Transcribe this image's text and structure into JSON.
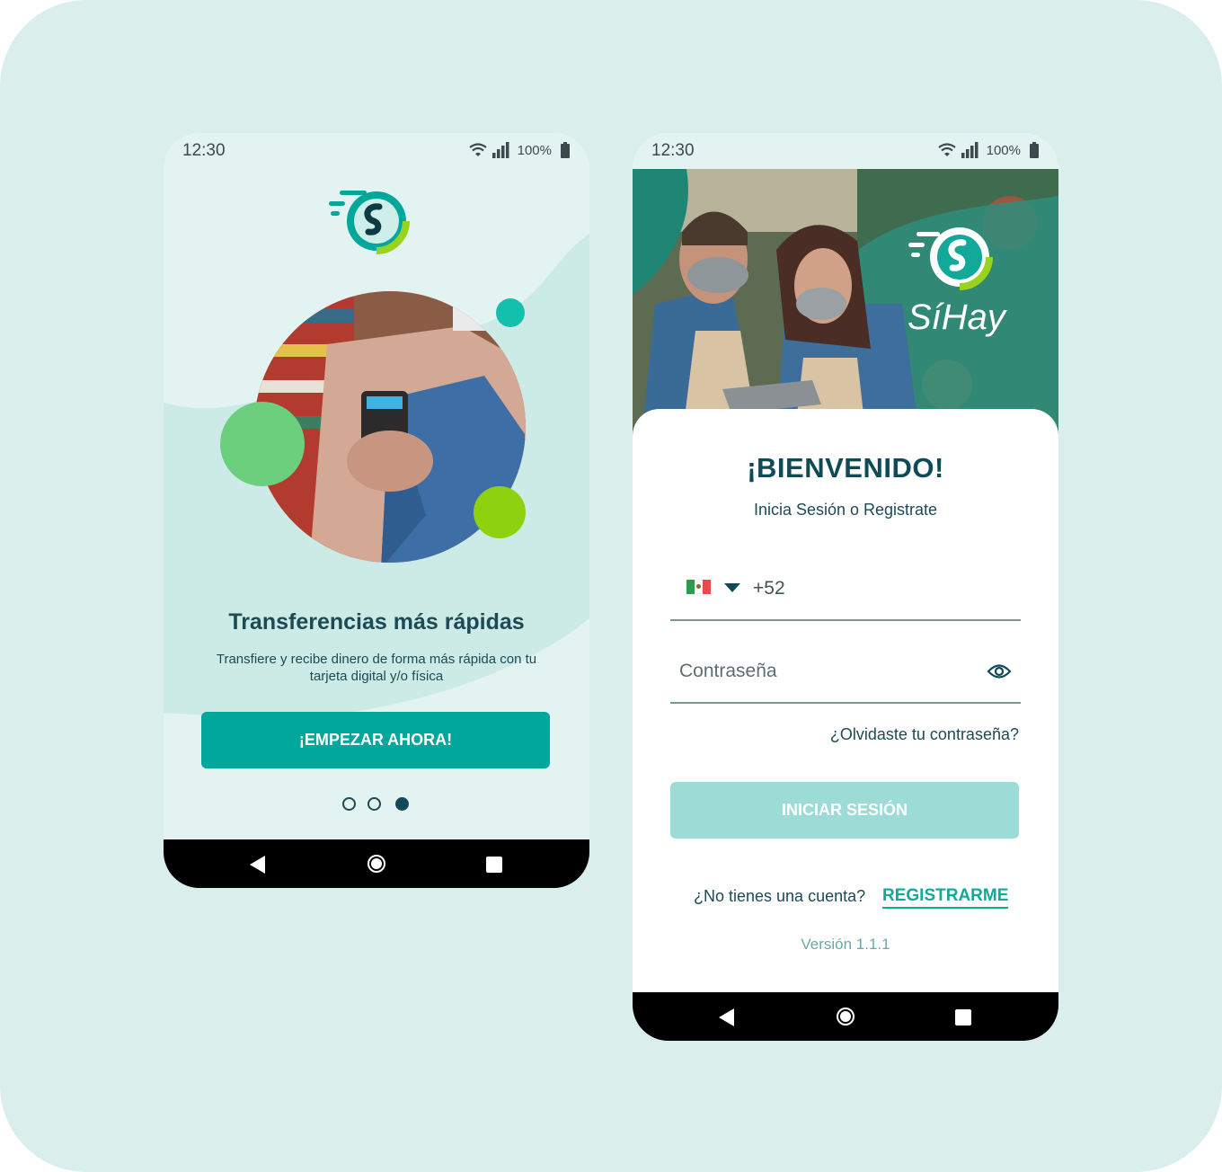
{
  "colors": {
    "background": "#daefec",
    "primary": "#02a79b",
    "primary_disabled": "#9ddcd6",
    "dark_teal": "#0f4b57",
    "accent_green": "#9bd21b"
  },
  "left_screen": {
    "status": {
      "time": "12:30",
      "battery": "100%"
    },
    "title": "Transferencias más rápidas",
    "description": "Transfiere y recibe dinero de forma más rápida con tu tarjeta digital y/o física",
    "start_button": "¡EMPEZAR AHORA!",
    "pager": {
      "pages": 3,
      "current": 3
    },
    "icons": [
      "wifi-icon",
      "signal-icon",
      "battery-icon",
      "logo-icon",
      "back-icon",
      "home-icon",
      "recents-icon"
    ]
  },
  "right_screen": {
    "status": {
      "time": "12:30",
      "battery": "100%"
    },
    "brand": "SíHay",
    "welcome_title": "¡BIENVENIDO!",
    "welcome_subtitle": "Inicia Sesión o Registrate",
    "phone_field": {
      "country": "MX",
      "code": "+52"
    },
    "password_field": {
      "placeholder": "Contraseña"
    },
    "forgot_link": "¿Olvidaste tu contraseña?",
    "login_button": "INICIAR SESIÓN",
    "no_account_text": "¿No tienes una cuenta?",
    "register_link": "REGISTRARME",
    "version": "Versión 1.1.1",
    "icons": [
      "flag-mexico-icon",
      "chevron-down-icon",
      "eye-icon"
    ]
  }
}
